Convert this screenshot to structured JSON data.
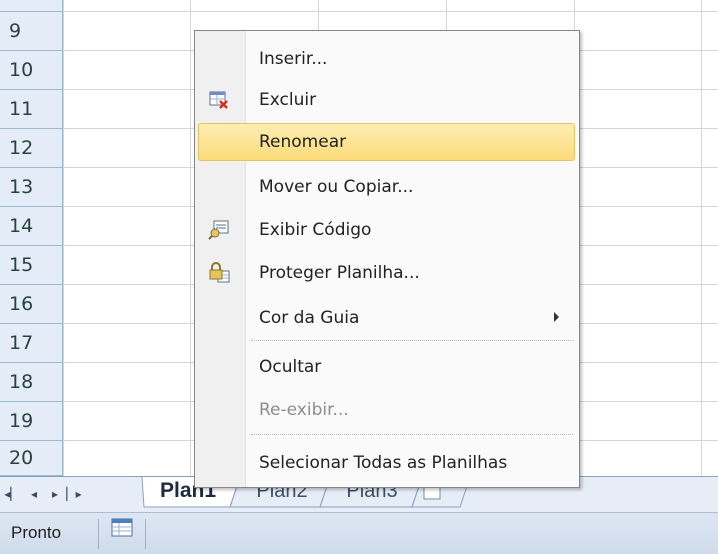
{
  "rows": [
    "9",
    "10",
    "11",
    "12",
    "13",
    "14",
    "15",
    "16",
    "17",
    "18",
    "19",
    "20"
  ],
  "context_menu": {
    "items": [
      {
        "label": "Inserir...",
        "icon": "",
        "disabled": false
      },
      {
        "label": "Excluir",
        "icon": "delete-sheet-icon",
        "disabled": false
      },
      {
        "label": "Renomear",
        "icon": "",
        "disabled": false,
        "highlighted": true
      },
      {
        "label": "Mover ou Copiar...",
        "icon": "",
        "disabled": false
      },
      {
        "label": "Exibir Código",
        "icon": "view-code-icon",
        "disabled": false
      },
      {
        "label": "Proteger Planilha...",
        "icon": "lock-sheet-icon",
        "disabled": false
      },
      {
        "label": "Cor da Guia",
        "icon": "",
        "disabled": false,
        "submenu": true
      },
      {
        "label": "Ocultar",
        "icon": "",
        "disabled": false
      },
      {
        "label": "Re-exibir...",
        "icon": "",
        "disabled": true
      },
      {
        "label": "Selecionar Todas as Planilhas",
        "icon": "",
        "disabled": false
      }
    ]
  },
  "sheet_tabs": [
    {
      "label": "Plan1",
      "active": true
    },
    {
      "label": "Plan2",
      "active": false
    },
    {
      "label": "Plan3",
      "active": false
    }
  ],
  "nav_buttons": [
    "first-sheet",
    "prev-sheet",
    "next-sheet",
    "last-sheet"
  ],
  "status_bar": {
    "status": "Pronto"
  },
  "colors": {
    "highlight": "#fbdb79",
    "row_header": "#e4ecf7",
    "tab_bar": "#e6edf6"
  }
}
